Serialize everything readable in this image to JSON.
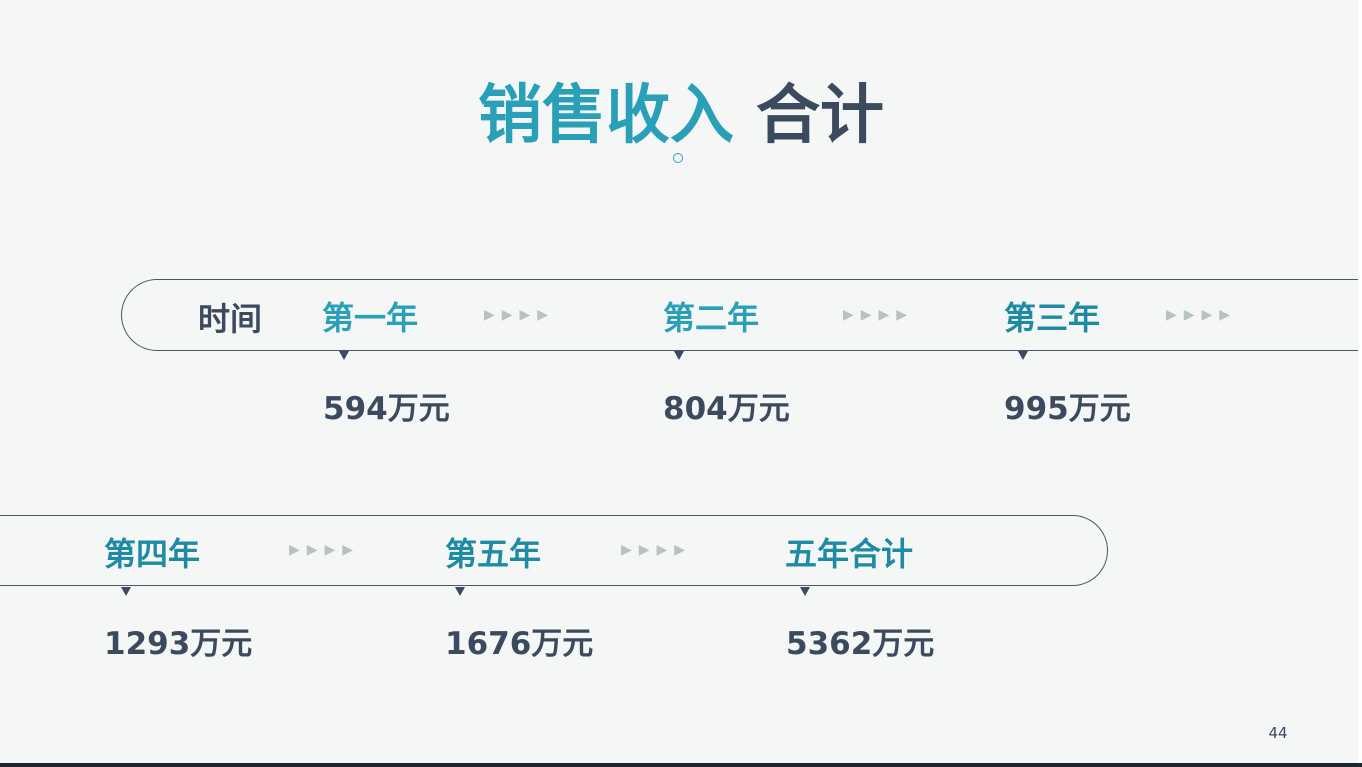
{
  "title": {
    "accent": "销售收入",
    "rest": "合计"
  },
  "timeline": {
    "row_label": "时间",
    "arrows": "▶▶▶▶",
    "items": [
      {
        "label": "第一年",
        "value": "594万元"
      },
      {
        "label": "第二年",
        "value": "804万元"
      },
      {
        "label": "第三年",
        "value": "995万元"
      },
      {
        "label": "第四年",
        "value": "1293万元"
      },
      {
        "label": "第五年",
        "value": "1676万元"
      },
      {
        "label": "五年合计",
        "value": "5362万元"
      }
    ]
  },
  "page_number": "44",
  "colors": {
    "accent": "#2aa0b8",
    "dark": "#3c4a5e",
    "arrow": "#b7c2c7",
    "background": "#f5f7f7"
  }
}
